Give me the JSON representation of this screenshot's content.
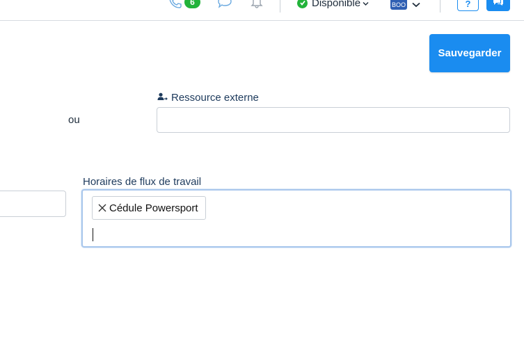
{
  "topbar": {
    "call_badge": "6",
    "status_label": "Disponible",
    "avatar_text": "BOO",
    "help_label": "?"
  },
  "toolbar": {
    "save_label": "Sauvegarder"
  },
  "form": {
    "external_resource_label": "Ressource externe",
    "external_resource_value": "",
    "or_label": "ou",
    "workflow_schedules_label": "Horaires de flux de travail",
    "workflow_chips": [
      "Cédule Powersport"
    ]
  },
  "colors": {
    "accent": "#1a8cf0",
    "success": "#22b33a",
    "focus_border": "#a9c7ec"
  }
}
